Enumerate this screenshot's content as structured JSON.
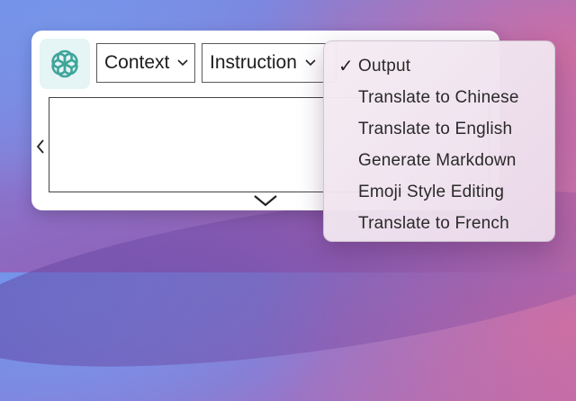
{
  "toolbar": {
    "context_label": "Context",
    "instruction_label": "Instruction"
  },
  "instruction_menu": {
    "items": [
      {
        "label": "Output",
        "checked": true
      },
      {
        "label": "Translate to Chinese",
        "checked": false
      },
      {
        "label": "Translate to English",
        "checked": false
      },
      {
        "label": "Generate Markdown",
        "checked": false
      },
      {
        "label": "Emoji Style Editing",
        "checked": false
      },
      {
        "label": "Translate to French",
        "checked": false
      }
    ],
    "check_glyph": "✓"
  },
  "colors": {
    "icon_bg": "#e5f4f5",
    "icon_fg": "#3fa59a"
  },
  "icons": {
    "app": "openai-logo-icon",
    "left": "chevron-left-icon",
    "down": "chevron-down-icon"
  }
}
